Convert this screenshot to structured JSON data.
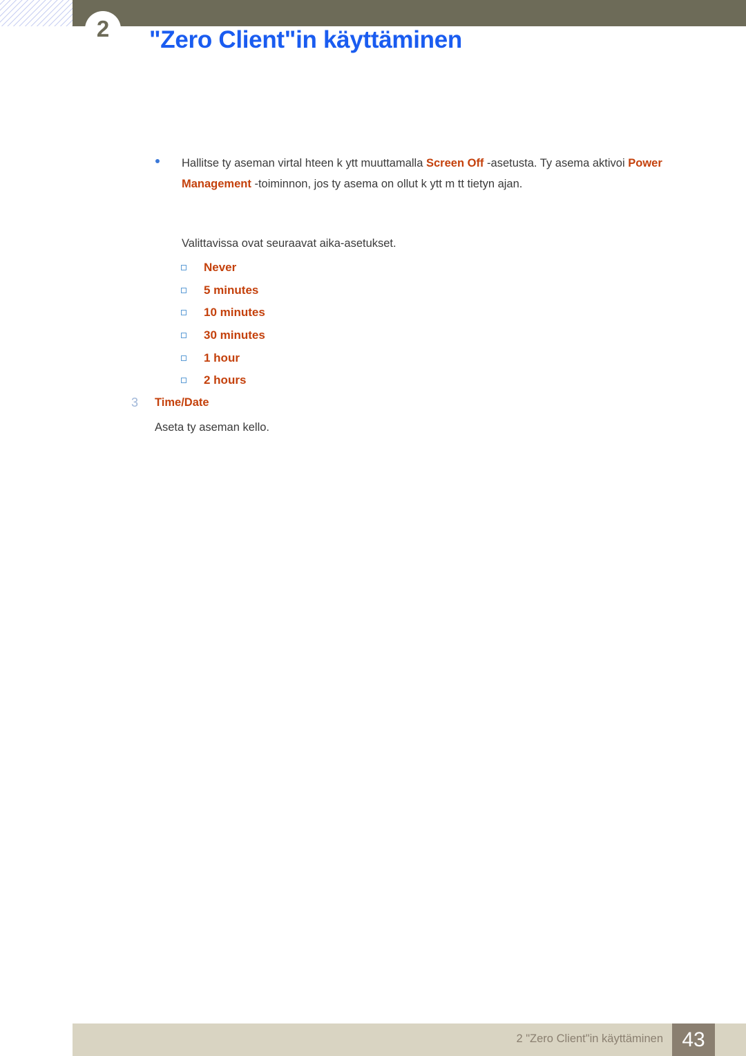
{
  "header": {
    "chapter_number": "2",
    "title": "\"Zero Client\"in käyttäminen",
    "bar_color": "#6d6b58",
    "title_color": "#1a5cf0"
  },
  "content": {
    "bullet": {
      "line1_part1": "Hallitse ty aseman virtal hteen k ytt  muuttamalla  ",
      "keyword1": "Screen Off",
      "line1_part2": " -asetusta. Ty asema aktivoi ",
      "keyword2": "Power Management",
      "line2_part2": " -toiminnon, jos ty asema on ollut k ytt m tt  tietyn ajan."
    },
    "intro_paragraph": "Valittavissa ovat seuraavat aika-asetukset.",
    "options": [
      {
        "label": "Never"
      },
      {
        "label": "5 minutes"
      },
      {
        "label": "10 minutes"
      },
      {
        "label": "30 minutes"
      },
      {
        "label": "1 hour"
      },
      {
        "label": "2 hours"
      }
    ],
    "section": {
      "number": "3",
      "title": "Time/Date",
      "body": "Aseta ty aseman kello."
    },
    "accent_color": "#c4410c",
    "bullet_color": "#5b9bd5"
  },
  "footer": {
    "text": "2 \"Zero Client\"in käyttäminen",
    "page_number": "43",
    "bar_color": "#d9d4c2",
    "badge_color": "#8a7f70"
  }
}
